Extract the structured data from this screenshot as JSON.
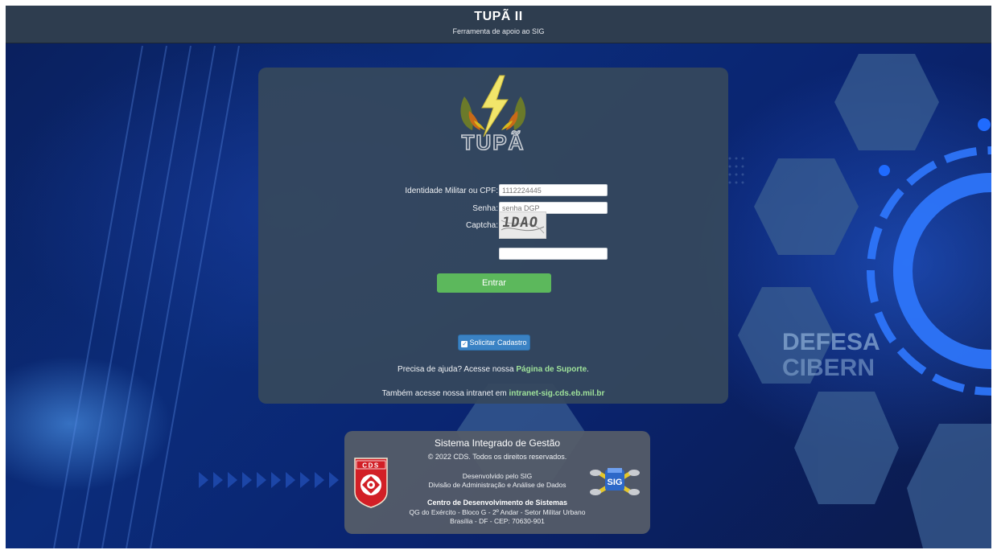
{
  "header": {
    "title": "TUPÃ II",
    "subtitle": "Ferramenta de apoio ao SIG"
  },
  "login": {
    "logo_text": "TUPÃ",
    "identity_label": "Identidade Militar ou CPF:",
    "identity_placeholder": "1112224445",
    "password_label": "Senha:",
    "password_placeholder": "senha DGP",
    "captcha_label": "Captcha:",
    "captcha_text": "1DAO",
    "captcha_value": "",
    "submit_label": "Entrar",
    "register_label": "Solicitar Cadastro",
    "help_text": "Precisa de ajuda? Acesse nossa ",
    "help_link": "Página de Suporte",
    "help_suffix": ".",
    "intranet_text": "Também acesse nossa intranet em ",
    "intranet_link": "intranet-sig.cds.eb.mil.br"
  },
  "footer": {
    "title": "Sistema Integrado de Gestão",
    "copyright": "2022 CDS. Todos os direitos reservados.",
    "developed_by": "Desenvolvido pelo SIG",
    "division": "Divisão de Administração e Análise de Dados",
    "org_name": "Centro de Desenvolvimento de Sistemas",
    "address_line1": "QG do Exército - Bloco G - 2º Andar - Setor Militar Urbano",
    "address_line2": "Brasília - DF - CEP: 70630-901",
    "cds_badge_text": "CDS",
    "sig_logo_text": "SIG"
  },
  "background": {
    "watermark_text1": "DEFESA",
    "watermark_text2": "CIBERN"
  },
  "colors": {
    "header_bg": "#2e3d4f",
    "panel_bg": "#36485c",
    "submit_green": "#5cb85c",
    "register_blue": "#3a82c4",
    "link_green": "#9fe29a"
  }
}
